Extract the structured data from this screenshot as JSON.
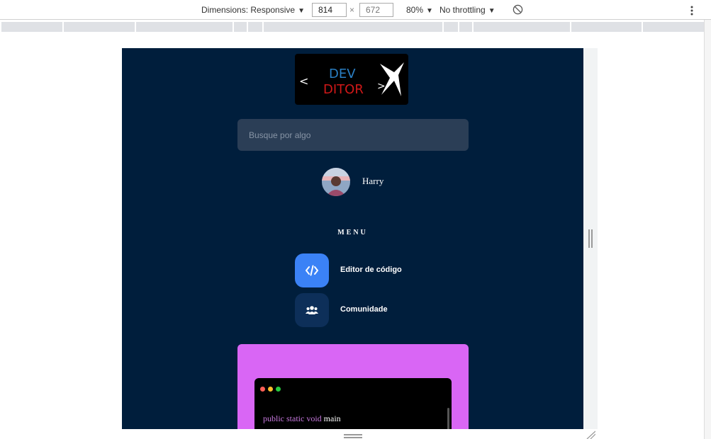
{
  "devtools": {
    "dimensions_label": "Dimensions: Responsive",
    "width_value": "814",
    "height_value": "672",
    "times_sign": "×",
    "zoom": "80%",
    "throttling": "No throttling"
  },
  "app": {
    "logo_text": {
      "left_bracket": "<",
      "line1": "DEV",
      "line2": "DITOR",
      "right_bracket": ">"
    },
    "search": {
      "placeholder": "Busque por algo"
    },
    "user": {
      "name": "Harry"
    },
    "menu": {
      "title": "MENU",
      "items": [
        {
          "label": "Editor de código",
          "icon": "code-icon"
        },
        {
          "label": "Comunidade",
          "icon": "users-icon"
        }
      ]
    },
    "code_preview": {
      "keywords": "public static void",
      "function_name": "main"
    }
  },
  "colors": {
    "page_background": "#001e3c",
    "search_background": "#2b3e56",
    "menu_active": "#3b82f6",
    "menu_inactive": "#0d2f59",
    "card_background": "#d966f5",
    "logo_dev": "#2a7fc4",
    "logo_ditor": "#d01818"
  }
}
